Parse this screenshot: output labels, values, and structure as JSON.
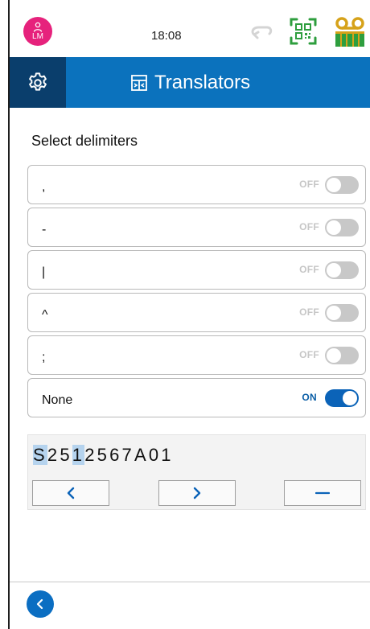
{
  "status_bar": {
    "user_initials": "LM",
    "time": "18:08",
    "avatar_color": "#e6227c",
    "qr_icon_color": "#2e9e3e",
    "tape_icon_color": "#d6a21a"
  },
  "header": {
    "title": "Translators",
    "background": "#0b72bd",
    "settings_tab_background": "#0a3e6c"
  },
  "page": {
    "heading": "Select delimiters"
  },
  "delimiters": [
    {
      "symbol": ",",
      "state": "OFF",
      "enabled": false
    },
    {
      "symbol": "-",
      "state": "OFF",
      "enabled": false
    },
    {
      "symbol": "|",
      "state": "OFF",
      "enabled": false
    },
    {
      "symbol": "^",
      "state": "OFF",
      "enabled": false
    },
    {
      "symbol": ";",
      "state": "OFF",
      "enabled": false
    },
    {
      "symbol": "None",
      "state": "ON",
      "enabled": true
    }
  ],
  "preview": {
    "barcode_value": "S2512567A01",
    "highlighted_characters": [
      "S",
      "1"
    ]
  },
  "navigation": {
    "prev_icon": "chevron-left-icon",
    "next_icon": "chevron-right-icon",
    "minus_icon": "minus-icon",
    "back_icon": "chevron-left-icon"
  }
}
